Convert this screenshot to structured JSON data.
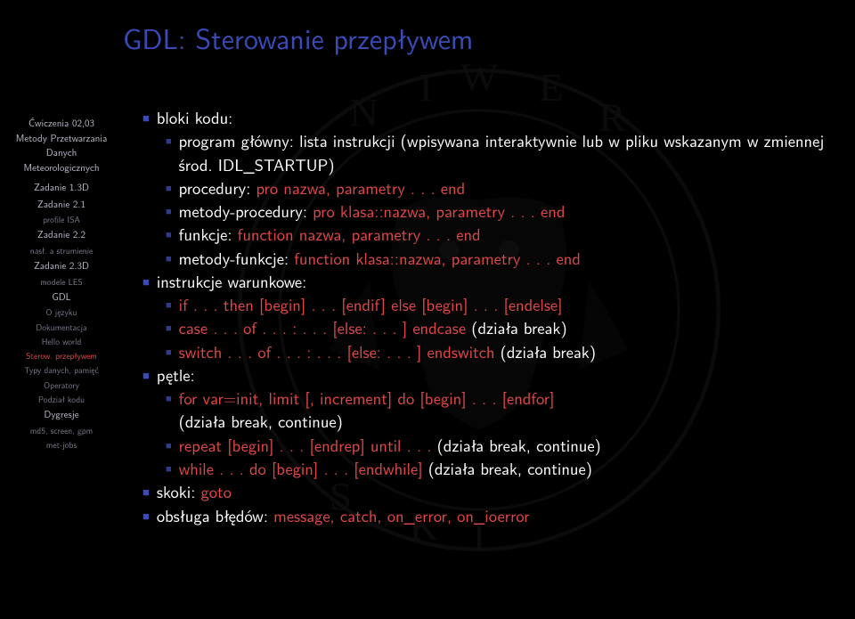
{
  "sidebar": {
    "presentation": [
      "Ćwiczenia 02,03",
      "Metody Przetwarzania Danych Meteorologicznych"
    ],
    "items": [
      {
        "label": "Zadanie 1.3D",
        "cls": "side-main"
      },
      {
        "label": "Zadanie 2.1",
        "cls": "side-main"
      },
      {
        "label": "profile ISA",
        "cls": "side-sub"
      },
      {
        "label": "Zadanie 2.2",
        "cls": "side-main"
      },
      {
        "label": "nasł. a strumienie",
        "cls": "side-sub"
      },
      {
        "label": "Zadanie 2.3D",
        "cls": "side-main"
      },
      {
        "label": "modele LES",
        "cls": "side-sub"
      },
      {
        "label": "GDL",
        "cls": "side-main"
      },
      {
        "label": "O języku",
        "cls": "side-sub"
      },
      {
        "label": "Dokumentacja",
        "cls": "side-sub"
      },
      {
        "label": "Hello world",
        "cls": "side-sub"
      },
      {
        "label": "Sterow. przepływem",
        "cls": "side-active"
      },
      {
        "label": "Typy danych, pamięć",
        "cls": "side-sub"
      },
      {
        "label": "Operatory",
        "cls": "side-sub"
      },
      {
        "label": "Podział kodu",
        "cls": "side-sub"
      },
      {
        "label": "Dygresje",
        "cls": "side-main"
      },
      {
        "label": "md5, screen, gpm",
        "cls": "side-sub"
      },
      {
        "label": "met-jobs",
        "cls": "side-sub"
      }
    ]
  },
  "title": "GDL: Sterowanie przepływem",
  "b1": "bloki kodu:",
  "b1a_1": "program główny: lista instrukcji (wpisywana interaktywnie lub w pliku wskazanym w zmiennej środ. IDL_STARTUP)",
  "b1b_1": "procedury: ",
  "b1b_r": "pro nazwa, parametry . . . end",
  "b1c_1": "metody-procedury: ",
  "b1c_r": "pro klasa::nazwa, parametry . . . end",
  "b1d_1": "funkcje: ",
  "b1d_r": "function nazwa, parametry . . . end",
  "b1e_1": "metody-funkcje: ",
  "b1e_r": "function klasa::nazwa, parametry . . . end",
  "b2": "instrukcje warunkowe:",
  "b2a_r1": "if . . . then [begin] . . . [endif] else [begin] . . . [endelse]",
  "b2b_r1": "case . . . of . . . : . . . [else: . . . ] endcase",
  "b2b_t": " (działa break)",
  "b2c_r1": "switch . . . of . . . : . . . [else: . . . ] endswitch",
  "b2c_t": " (działa break)",
  "b3": "pętle:",
  "b3a_r1": "for var=init, limit [, increment] do [begin] . . . [endfor]",
  "b3a_t": "(działa break, continue)",
  "b3b_r1": "repeat [begin] . . . [endrep] until . . . ",
  "b3b_t": " (działa break, continue)",
  "b3c_r1": "while . . . do [begin] . . . [endwhile]",
  "b3c_t": " (działa break, continue)",
  "b4_1": "skoki: ",
  "b4_r": "goto",
  "b5_1": "obsługa błędów: ",
  "b5_r": "message, catch, on_error, on_ioerror"
}
